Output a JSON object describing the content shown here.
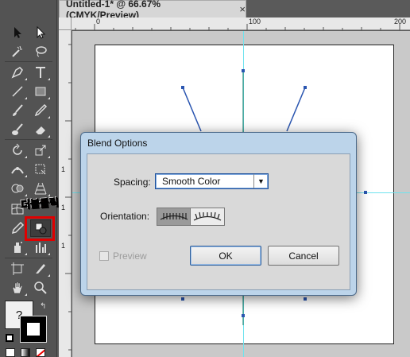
{
  "document_tab": {
    "title": "Untitled-1* @ 66.67% (CMYK/Preview)",
    "close": "×"
  },
  "ruler": {
    "top_labels": [
      "0",
      "100",
      "200"
    ],
    "left_labels": [
      "1",
      "1",
      "1"
    ]
  },
  "annotation": {
    "text": "더블클릭"
  },
  "dialog": {
    "title": "Blend Options",
    "spacing_label": "Spacing:",
    "spacing_value": "Smooth Color",
    "orientation_label": "Orientation:",
    "orientation_options": [
      "align-to-page",
      "align-to-path"
    ],
    "orientation_selected": "align-to-page",
    "preview_label": "Preview",
    "preview_checked": false,
    "ok_label": "OK",
    "cancel_label": "Cancel"
  },
  "tools": [
    "selection-tool",
    "direct-selection-tool",
    "magic-wand-tool",
    "lasso-tool",
    "pen-tool",
    "type-tool",
    "line-segment-tool",
    "rectangle-tool",
    "paintbrush-tool",
    "pencil-tool",
    "blob-brush-tool",
    "eraser-tool",
    "rotate-tool",
    "scale-tool",
    "width-tool",
    "free-transform-tool",
    "shape-builder-tool",
    "perspective-grid-tool",
    "mesh-tool",
    "gradient-tool",
    "eyedropper-tool",
    "blend-tool",
    "symbol-sprayer-tool",
    "column-graph-tool",
    "artboard-tool",
    "slice-tool",
    "hand-tool",
    "zoom-tool"
  ],
  "colors": {
    "accent_highlight": "#e00000",
    "guide": "#6fe3ee",
    "path": "#2a55b0"
  }
}
